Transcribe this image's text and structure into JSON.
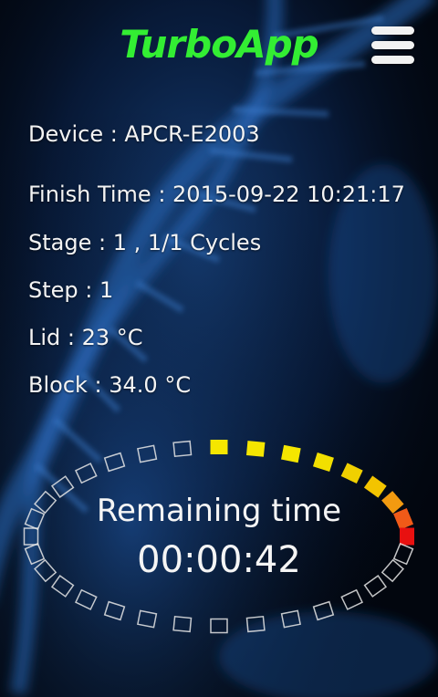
{
  "app": {
    "title": "TurboApp",
    "title_color": "#33ee33",
    "menu_icon": "hamburger-menu-icon"
  },
  "info": {
    "device": "Device : APCR-E2003",
    "finish_time": "Finish Time : 2015-09-22 10:21:17",
    "stage": "Stage : 1 , 1/1 Cycles",
    "step": "Step : 1",
    "lid": "Lid : 23 °C",
    "block": "Block : 34.0 °C"
  },
  "timer": {
    "label": "Remaining time",
    "value": "00:00:42",
    "progress_segments_filled": 9,
    "segment_colors": [
      "#f5e600",
      "#f5e600",
      "#f5e600",
      "#f2df00",
      "#f0d000",
      "#f3c400",
      "#f29a10",
      "#f05a18",
      "#e81010"
    ]
  }
}
